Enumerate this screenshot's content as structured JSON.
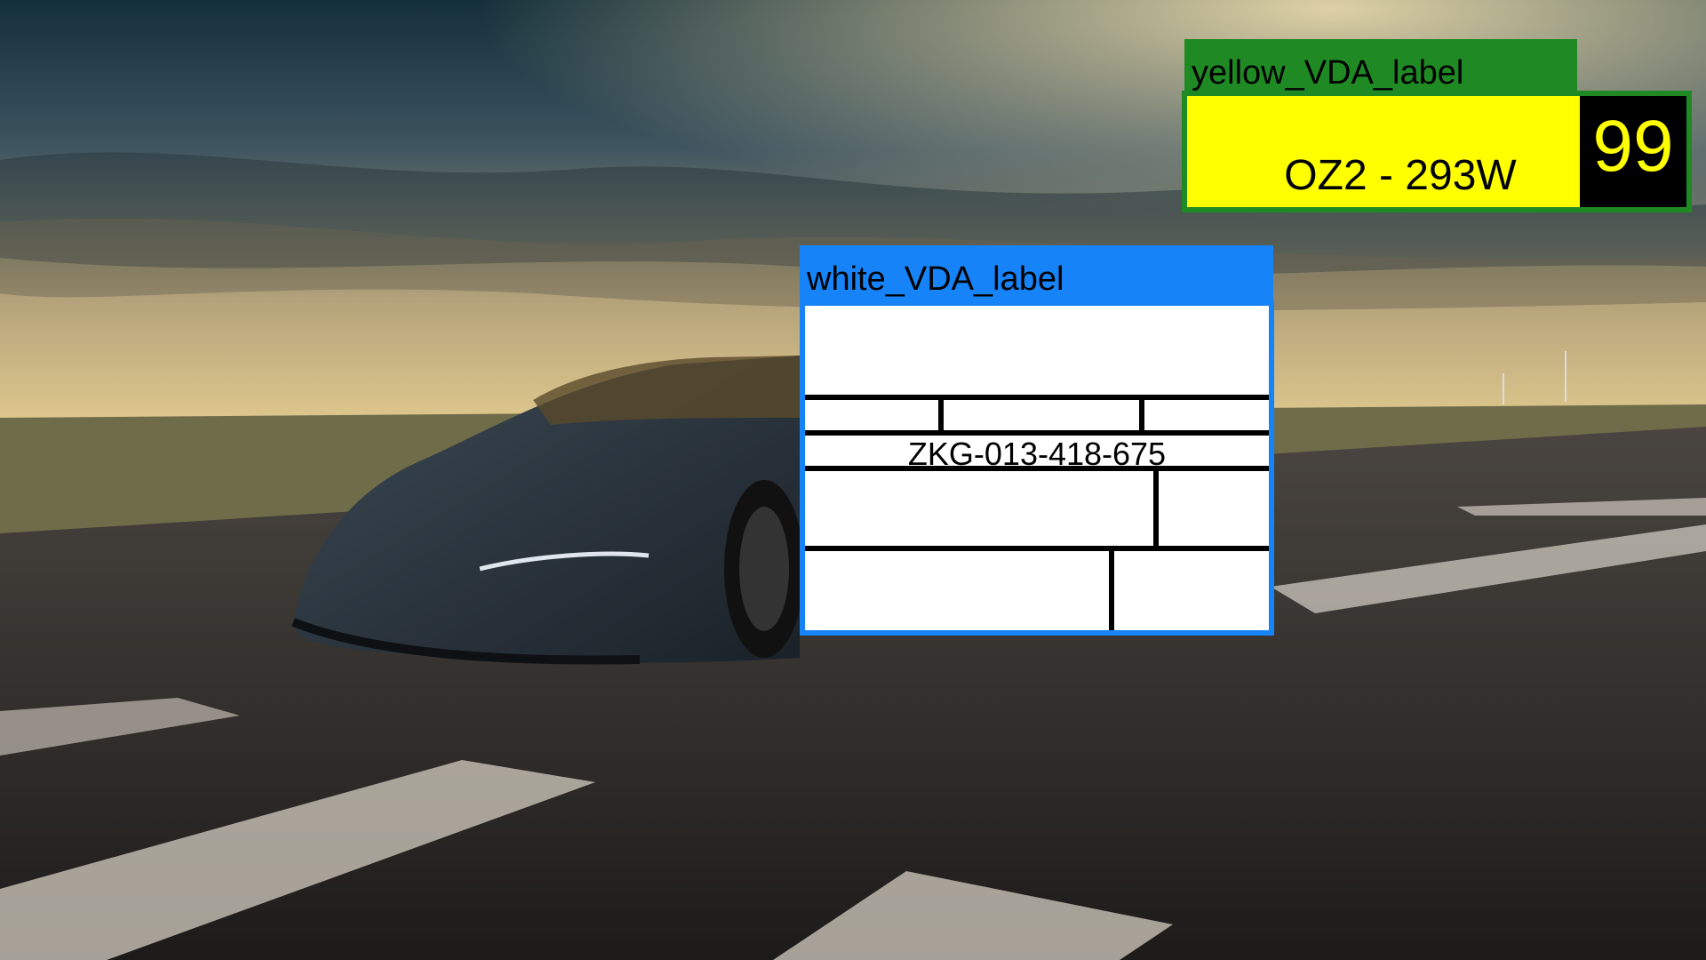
{
  "labels": {
    "yellow": {
      "tag": "yellow_VDA_label",
      "text": "OZ2 - 293W",
      "number": "99"
    },
    "white": {
      "tag": "white_VDA_label",
      "code": "ZKG-013-418-675"
    }
  },
  "colors": {
    "yellow_tag": "#1f8a24",
    "yellow_fill": "#ffff00",
    "white_tag": "#1684f8"
  }
}
